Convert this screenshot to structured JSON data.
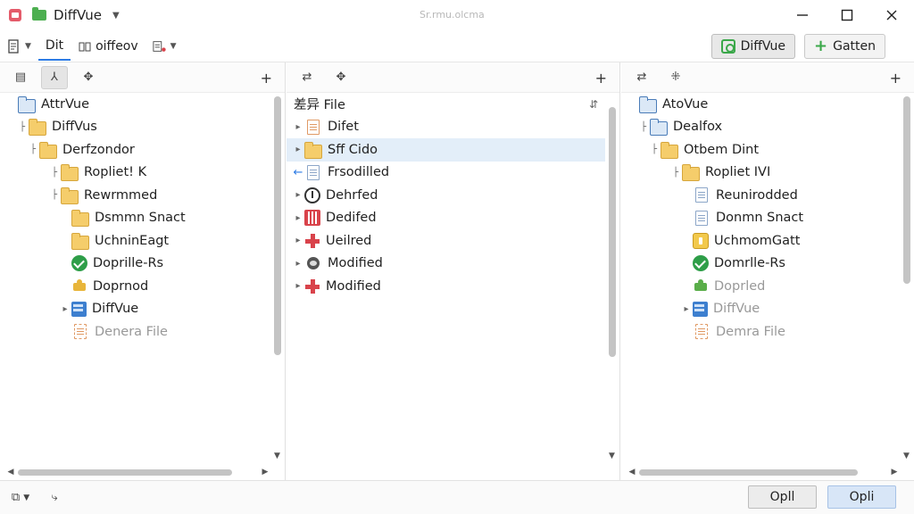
{
  "window": {
    "title": "DiffVue",
    "center_caption": "Sr.rmu.olcma"
  },
  "toolbar": {
    "items": [
      {
        "label": "",
        "icon": "document-list-icon"
      },
      {
        "label": "Dit",
        "icon": ""
      },
      {
        "label": "oiffeov",
        "icon": "split-icon"
      },
      {
        "label": "",
        "icon": "settings-list-icon"
      }
    ],
    "right_buttons": [
      {
        "label": "DiffVue",
        "icon": "search-green-icon"
      },
      {
        "label": "Gatten",
        "icon": "plus-green-icon"
      }
    ]
  },
  "left_pane": {
    "rows": [
      {
        "label": "AttrVue",
        "icon": "folder-blue-icon",
        "indent": 0,
        "arrow": ""
      },
      {
        "label": "DiffVus",
        "icon": "folder-icon",
        "indent": 1,
        "arrow": "├"
      },
      {
        "label": "Derfzondor",
        "icon": "folder-icon",
        "indent": 2,
        "arrow": "├"
      },
      {
        "label": "Ropliet! K",
        "icon": "folder-icon",
        "indent": 4,
        "arrow": "├"
      },
      {
        "label": "Rewrmmed",
        "icon": "folder-icon",
        "indent": 4,
        "arrow": "├"
      },
      {
        "label": "Dsmmn Snact",
        "icon": "folder-icon",
        "indent": 5,
        "arrow": ""
      },
      {
        "label": "UchninEagt",
        "icon": "folder-icon",
        "indent": 5,
        "arrow": ""
      },
      {
        "label": "Doprille-Rs",
        "icon": "check-icon",
        "indent": 5,
        "arrow": ""
      },
      {
        "label": "Doprnod",
        "icon": "puzzle-icon",
        "indent": 5,
        "arrow": ""
      },
      {
        "label": "DiffVue",
        "icon": "calculator-icon",
        "indent": 5,
        "arrow": "▸"
      },
      {
        "label": "Denera File",
        "icon": "file-dashed-icon",
        "indent": 5,
        "arrow": "",
        "dim": true
      }
    ]
  },
  "middle_pane": {
    "header": "差异 File",
    "rows": [
      {
        "label": "Difet",
        "icon": "file-orange-icon",
        "arrow": "▸"
      },
      {
        "label": "Sff Cido",
        "icon": "folder-icon",
        "arrow": "▸",
        "selected": true
      },
      {
        "label": "Frsodilled",
        "icon": "file-icon",
        "arrow": "←"
      },
      {
        "label": "Dehrfed",
        "icon": "clock-icon",
        "arrow": "▸"
      },
      {
        "label": "Dedifed",
        "icon": "red-book-icon",
        "arrow": "▸"
      },
      {
        "label": "Ueilred",
        "icon": "red-plus-icon",
        "arrow": "▸"
      },
      {
        "label": "Modified",
        "icon": "cloud-icon",
        "arrow": "▸"
      },
      {
        "label": "Modified",
        "icon": "red-plus-icon",
        "arrow": "▸"
      }
    ]
  },
  "right_pane": {
    "rows": [
      {
        "label": "AtoVue",
        "icon": "folder-blue-icon",
        "indent": 0,
        "arrow": ""
      },
      {
        "label": "Dealfox",
        "icon": "folder-blue-icon",
        "indent": 1,
        "arrow": "├"
      },
      {
        "label": "Otbem Dint",
        "icon": "folder-icon",
        "indent": 2,
        "arrow": "├"
      },
      {
        "label": "Ropliet IVI",
        "icon": "folder-icon",
        "indent": 4,
        "arrow": "├"
      },
      {
        "label": "Reunirodded",
        "icon": "file-icon",
        "indent": 5,
        "arrow": ""
      },
      {
        "label": "Donmn Snact",
        "icon": "file-icon",
        "indent": 5,
        "arrow": ""
      },
      {
        "label": "UchmomGatt",
        "icon": "tag-yellow-icon",
        "indent": 5,
        "arrow": ""
      },
      {
        "label": "Domrlle-Rs",
        "icon": "check-icon",
        "indent": 5,
        "arrow": ""
      },
      {
        "label": "Doprled",
        "icon": "puzzle-green-icon",
        "indent": 5,
        "arrow": "",
        "dim": true
      },
      {
        "label": "DiffVue",
        "icon": "calculator-icon",
        "indent": 5,
        "arrow": "▸",
        "dim": true
      },
      {
        "label": "Demra File",
        "icon": "file-orange-dashed-icon",
        "indent": 5,
        "arrow": "",
        "dim": true
      }
    ]
  },
  "statusbar": {
    "buttons": [
      {
        "label": "Opll"
      },
      {
        "label": "Opli"
      }
    ]
  },
  "colors": {
    "accent": "#2c7be5",
    "selection": "#e3eef9",
    "folder": "#f5cd6b",
    "green": "#3ba84a",
    "red": "#d9434b"
  }
}
